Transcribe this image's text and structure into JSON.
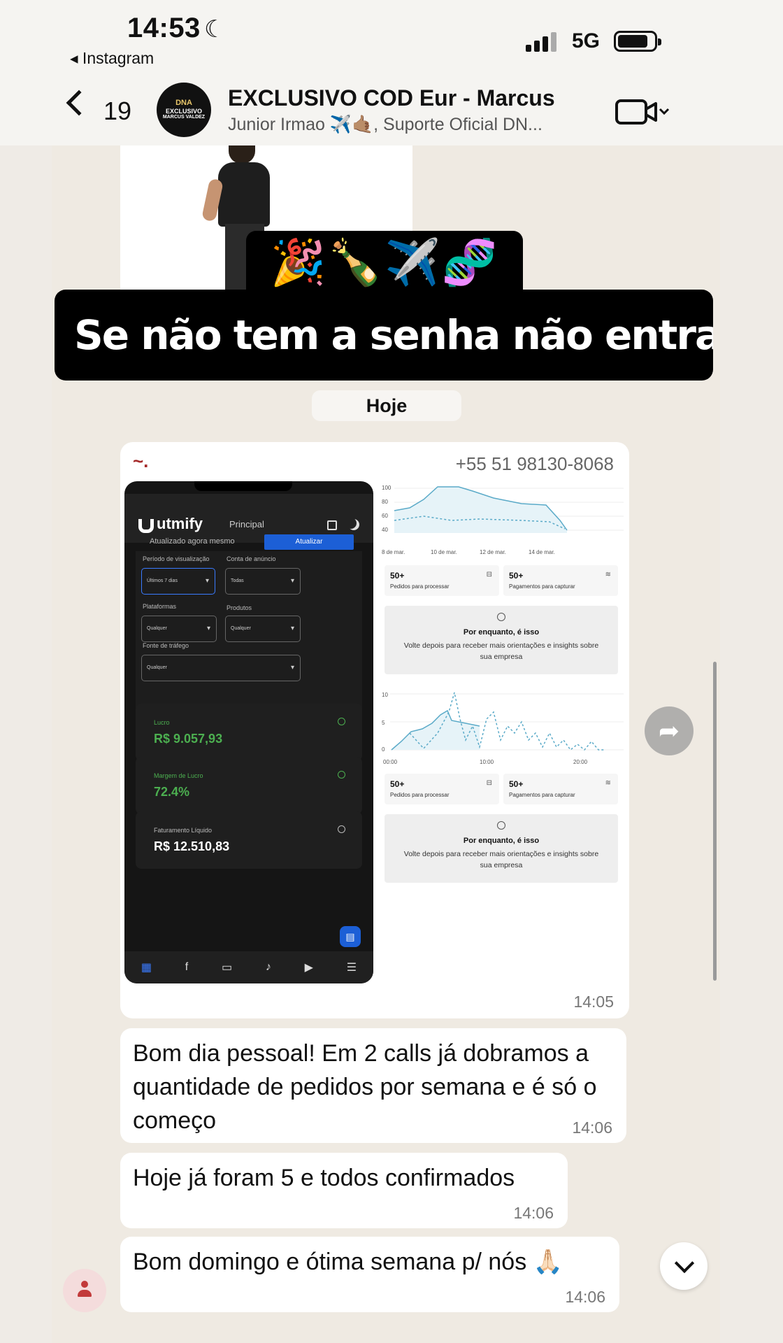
{
  "status_bar": {
    "time": "14:53",
    "back_app": "◂ Instagram",
    "network": "5G"
  },
  "header": {
    "unread_count": "19",
    "group_name": "EXCLUSIVO COD Eur - Marcus",
    "members": "Junior Irmao ✈️🤙🏽, Suporte Oficial DN...",
    "avatar_text": "DNA EXCLUSIVO MARCUS VALDEZ"
  },
  "sticker": {
    "emojis": "🎉🍾✈️🧬",
    "caption": "Se não tem a senha não entra não 🤙🏽👀"
  },
  "day_chip": "Hoje",
  "image_message": {
    "sender": "~.",
    "phone": "+55 51 98130-8068",
    "time": "14:05",
    "app": {
      "logo": "utmify",
      "tab": "Principal",
      "updated": "Atualizado agora mesmo",
      "update_button": "Atualizar",
      "filters": {
        "period_label": "Período de visualização",
        "period_value": "Últimos 7 dias",
        "account_label": "Conta de anúncio",
        "account_value": "Todas",
        "platforms_label": "Plataformas",
        "platforms_value": "Qualquer",
        "products_label": "Produtos",
        "products_value": "Qualquer",
        "traffic_label": "Fonte de tráfego",
        "traffic_value": "Qualquer"
      },
      "stats": [
        {
          "label": "Lucro",
          "value": "R$ 9.057,93"
        },
        {
          "label": "Margem de Lucro",
          "value": "72.4%"
        },
        {
          "label": "Faturamento Líquido",
          "value": "R$ 12.510,83"
        }
      ]
    },
    "dashboard": {
      "chart1": {
        "yticks": [
          "100",
          "80",
          "60",
          "40"
        ],
        "xticks": [
          "8 de mar.",
          "10 de mar.",
          "12 de mar.",
          "14 de mar."
        ]
      },
      "chart2": {
        "yticks": [
          "10",
          "5",
          "0"
        ],
        "xticks": [
          "00:00",
          "10:00",
          "20:00"
        ]
      },
      "cards": [
        {
          "num": "50+",
          "label": "Pedidos para processar"
        },
        {
          "num": "50+",
          "label": "Pagamentos para capturar"
        }
      ],
      "info_title": "Por enquanto, é isso",
      "info_text": "Volte depois para receber mais orientações e insights sobre sua empresa"
    }
  },
  "messages": [
    {
      "text": "Bom dia pessoal! Em 2 calls já dobramos a quantidade de pedidos por semana e é só o começo",
      "time": "14:06"
    },
    {
      "text": "Hoje já foram 5 e todos confirmados",
      "time": "14:06"
    },
    {
      "text": "Bom domingo e ótima semana p/ nós 🙏🏻",
      "time": "14:06"
    }
  ],
  "colors": {
    "chat_bg": "#efeae2",
    "bubble": "#ffffff",
    "sender_name": "#a52a2a",
    "app_dark": "#151515",
    "app_accent": "#1c5fd6",
    "profit_green": "#4caf50",
    "chart_line": "#5aaac8"
  },
  "icons": [
    "back-chevron-icon",
    "video-call-icon",
    "forward-icon",
    "scroll-down-icon",
    "mention-icon"
  ]
}
